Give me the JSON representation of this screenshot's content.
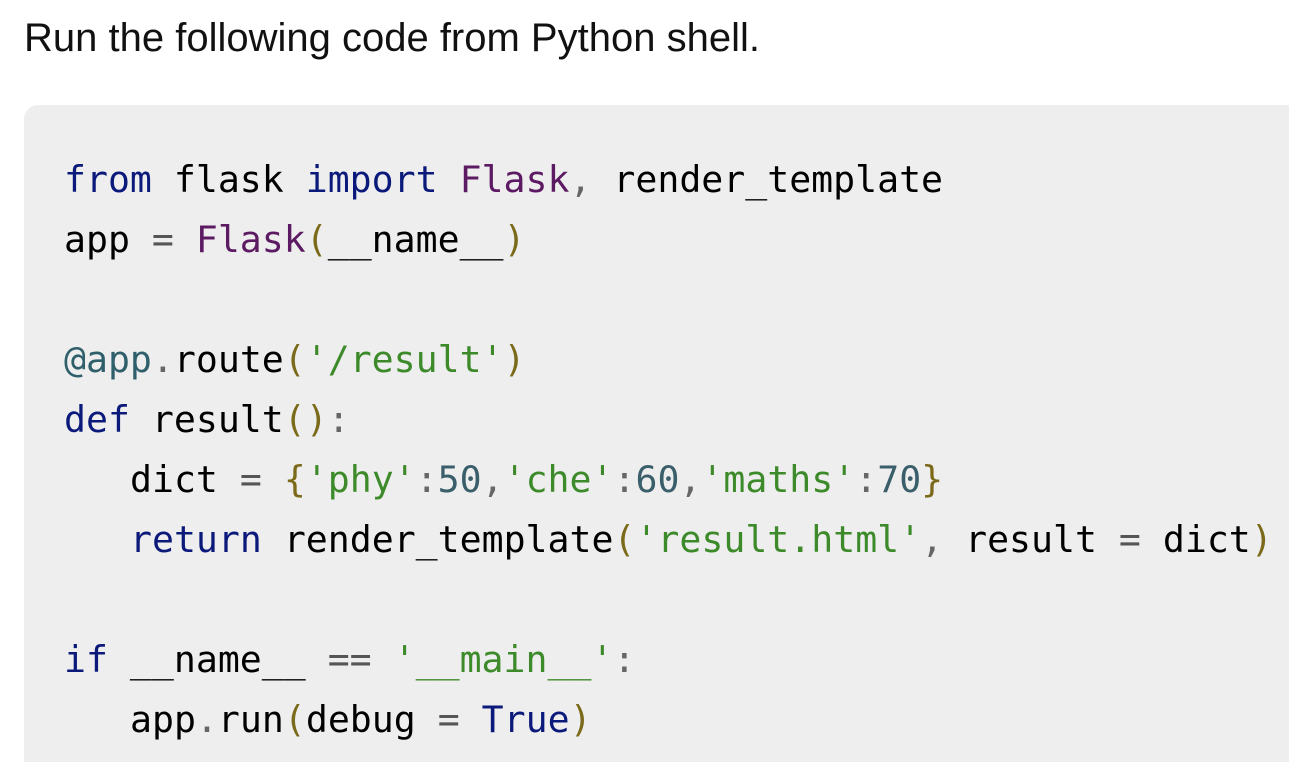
{
  "intro_text": "Run the following code from Python shell.",
  "code": {
    "language": "python",
    "lines": [
      {
        "tokens": [
          {
            "t": "kw",
            "v": "from"
          },
          {
            "t": "tx",
            "v": " flask "
          },
          {
            "t": "kw",
            "v": "import"
          },
          {
            "t": "tx",
            "v": " "
          },
          {
            "t": "cls",
            "v": "Flask"
          },
          {
            "t": "pn",
            "v": ", "
          },
          {
            "t": "tx",
            "v": "render_template"
          }
        ]
      },
      {
        "tokens": [
          {
            "t": "tx",
            "v": "app "
          },
          {
            "t": "op",
            "v": "= "
          },
          {
            "t": "cls",
            "v": "Flask"
          },
          {
            "t": "br",
            "v": "("
          },
          {
            "t": "tx",
            "v": "__name__"
          },
          {
            "t": "br",
            "v": ")"
          }
        ]
      },
      {
        "tokens": []
      },
      {
        "tokens": [
          {
            "t": "dec",
            "v": "@app"
          },
          {
            "t": "pn",
            "v": "."
          },
          {
            "t": "tx",
            "v": "route"
          },
          {
            "t": "br",
            "v": "("
          },
          {
            "t": "str",
            "v": "'/result'"
          },
          {
            "t": "br",
            "v": ")"
          }
        ]
      },
      {
        "tokens": [
          {
            "t": "kw",
            "v": "def"
          },
          {
            "t": "tx",
            "v": " result"
          },
          {
            "t": "br",
            "v": "()"
          },
          {
            "t": "pn",
            "v": ":"
          }
        ]
      },
      {
        "indent": true,
        "tokens": [
          {
            "t": "tx",
            "v": "dict "
          },
          {
            "t": "op",
            "v": "= "
          },
          {
            "t": "br",
            "v": "{"
          },
          {
            "t": "str",
            "v": "'phy'"
          },
          {
            "t": "pn",
            "v": ":"
          },
          {
            "t": "num",
            "v": "50"
          },
          {
            "t": "pn",
            "v": ","
          },
          {
            "t": "str",
            "v": "'che'"
          },
          {
            "t": "pn",
            "v": ":"
          },
          {
            "t": "num",
            "v": "60"
          },
          {
            "t": "pn",
            "v": ","
          },
          {
            "t": "str",
            "v": "'maths'"
          },
          {
            "t": "pn",
            "v": ":"
          },
          {
            "t": "num",
            "v": "70"
          },
          {
            "t": "br",
            "v": "}"
          }
        ]
      },
      {
        "indent": true,
        "tokens": [
          {
            "t": "kw",
            "v": "return"
          },
          {
            "t": "tx",
            "v": " render_template"
          },
          {
            "t": "br",
            "v": "("
          },
          {
            "t": "str",
            "v": "'result.html'"
          },
          {
            "t": "pn",
            "v": ", "
          },
          {
            "t": "tx",
            "v": "result "
          },
          {
            "t": "op",
            "v": "= "
          },
          {
            "t": "tx",
            "v": "dict"
          },
          {
            "t": "br",
            "v": ")"
          }
        ]
      },
      {
        "tokens": []
      },
      {
        "tokens": [
          {
            "t": "kw",
            "v": "if"
          },
          {
            "t": "tx",
            "v": " __name__ "
          },
          {
            "t": "op",
            "v": "=="
          },
          {
            "t": "tx",
            "v": " "
          },
          {
            "t": "str",
            "v": "'__main__'"
          },
          {
            "t": "pn",
            "v": ":"
          }
        ]
      },
      {
        "indent": true,
        "tokens": [
          {
            "t": "tx",
            "v": "app"
          },
          {
            "t": "pn",
            "v": "."
          },
          {
            "t": "tx",
            "v": "run"
          },
          {
            "t": "br",
            "v": "("
          },
          {
            "t": "tx",
            "v": "debug "
          },
          {
            "t": "op",
            "v": "= "
          },
          {
            "t": "kw",
            "v": "True"
          },
          {
            "t": "br",
            "v": ")"
          }
        ]
      }
    ]
  },
  "colors": {
    "keyword": "#0b1a7a",
    "class_name": "#5c1a63",
    "string": "#3d8a2a",
    "number": "#3a5f6b",
    "decorator": "#2f5f6b",
    "code_background": "#eeeeee"
  }
}
